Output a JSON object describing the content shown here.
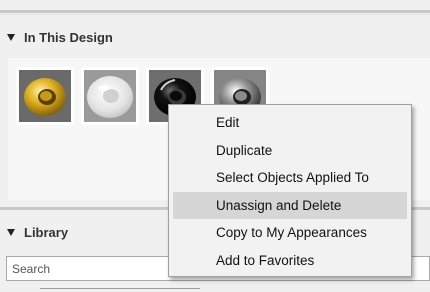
{
  "sections": {
    "in_this_design": {
      "title": "In This Design"
    },
    "library": {
      "title": "Library"
    }
  },
  "design_swatches": [
    {
      "name": "gold-appearance-icon",
      "color": "#d4a21a"
    },
    {
      "name": "glass-appearance-icon",
      "color": "#e8e8e8"
    },
    {
      "name": "black-gloss-appearance-icon",
      "color": "#111111"
    },
    {
      "name": "chrome-appearance-icon",
      "color": "#bcbcbc"
    }
  ],
  "search": {
    "placeholder": "Search",
    "value": ""
  },
  "context_menu": {
    "items": [
      {
        "label": "Edit"
      },
      {
        "label": "Duplicate"
      },
      {
        "label": "Select Objects Applied To"
      },
      {
        "label": "Unassign and Delete",
        "highlighted": true
      },
      {
        "label": "Copy to My Appearances"
      },
      {
        "label": "Add to Favorites"
      }
    ]
  }
}
